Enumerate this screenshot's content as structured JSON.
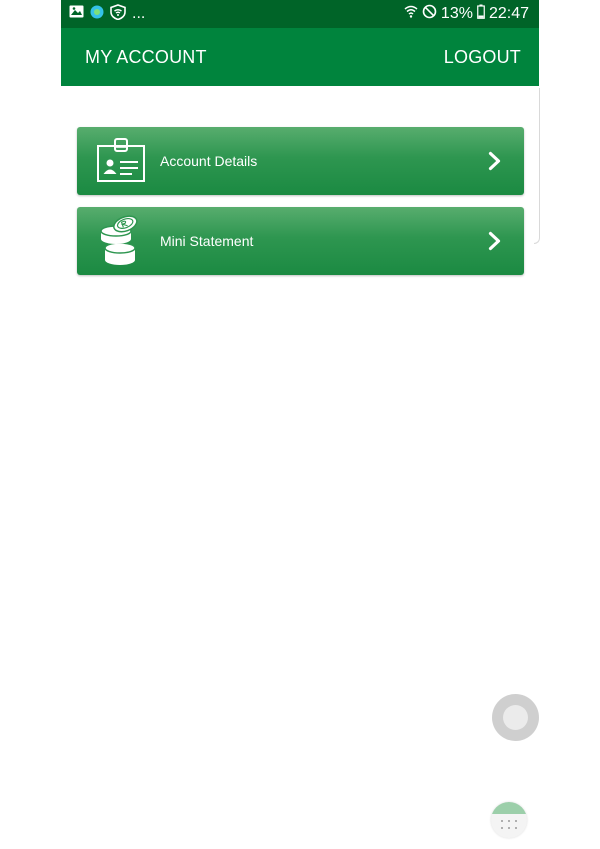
{
  "status_bar": {
    "overflow": "...",
    "battery": "13%",
    "time": "22:47",
    "icons": [
      "image-icon",
      "dot-icon",
      "shield-wifi-icon",
      "wifi-icon",
      "block-icon",
      "battery-icon"
    ]
  },
  "header": {
    "title": "MY ACCOUNT",
    "logout_label": "LOGOUT"
  },
  "menu": {
    "items": [
      {
        "label": "Account Details",
        "icon": "id-badge-icon"
      },
      {
        "label": "Mini Statement",
        "icon": "coin-stack-icon"
      }
    ]
  },
  "colors": {
    "status_bar": "#006428",
    "app_bar": "#00843d",
    "card_top": "#58ad6e",
    "card_bottom": "#1b8a42"
  },
  "floating": {
    "icons": [
      "assistive-touch-icon",
      "floating-widget-icon"
    ]
  }
}
